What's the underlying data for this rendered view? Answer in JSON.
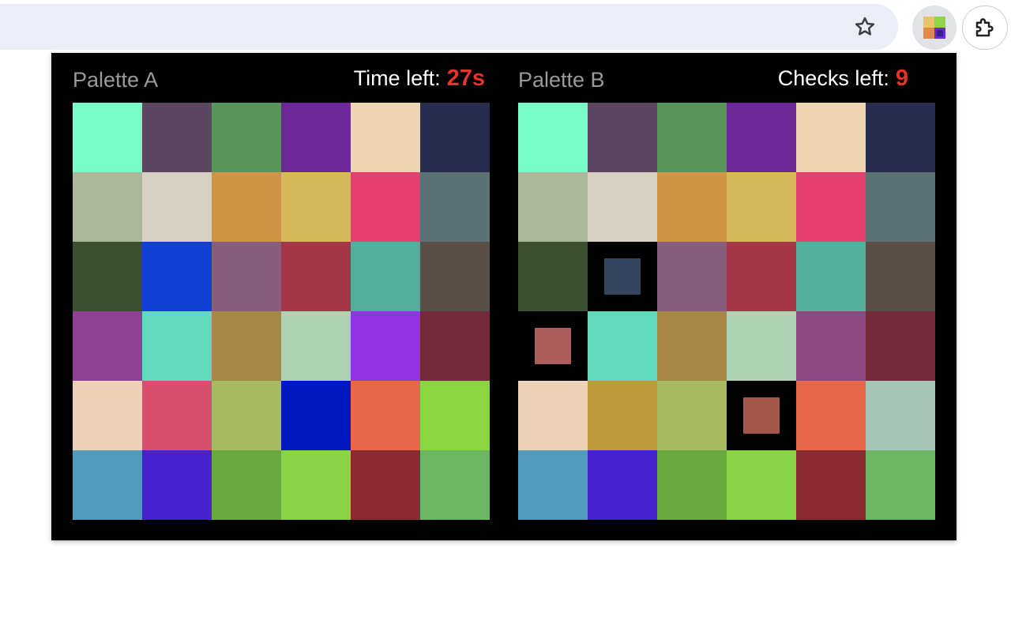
{
  "browser": {
    "star_icon": "star-outline-icon",
    "puzzle_icon": "puzzle-piece-icon",
    "extension_icon_colors": [
      "#e9c36b",
      "#8fd44a",
      "#e08a4a",
      "#6a2bd1"
    ],
    "extension_icon_inner": "#3a1f8e"
  },
  "palette_a": {
    "title": "Palette A",
    "stat_label": "Time left:",
    "stat_value": "27s",
    "cells": [
      "#78fbc6",
      "#5c4761",
      "#57955b",
      "#6b2896",
      "#edd4b3",
      "#282c4d",
      "#abb79a",
      "#d6d1c2",
      "#cf9346",
      "#d6b95a",
      "#e83f73",
      "#5b7374",
      "#3c4e32",
      "#1040d4",
      "#875e7c",
      "#a33648",
      "#54ae9b",
      "#5b5047",
      "#8d4294",
      "#62d9bc",
      "#a68745",
      "#add1b3",
      "#9333e3",
      "#742a3b",
      "#ecd2b8",
      "#d84e6f",
      "#a7ba62",
      "#0018c0",
      "#e6674a",
      "#8ad642",
      "#529bbd",
      "#4422cc",
      "#6aa942",
      "#8ad246",
      "#8a2b34",
      "#6cb562"
    ]
  },
  "palette_b": {
    "title": "Palette B",
    "stat_label": "Checks left:",
    "stat_value": "9",
    "cells": [
      {
        "color": "#78fbc6",
        "revealed": false
      },
      {
        "color": "#5c4761",
        "revealed": false
      },
      {
        "color": "#57955b",
        "revealed": false
      },
      {
        "color": "#6b2896",
        "revealed": false
      },
      {
        "color": "#edd4b3",
        "revealed": false
      },
      {
        "color": "#282c4d",
        "revealed": false
      },
      {
        "color": "#abb79a",
        "revealed": false
      },
      {
        "color": "#d6d1c2",
        "revealed": false
      },
      {
        "color": "#cf9346",
        "revealed": false
      },
      {
        "color": "#d6b95a",
        "revealed": false
      },
      {
        "color": "#e83f73",
        "revealed": false
      },
      {
        "color": "#5b7374",
        "revealed": false
      },
      {
        "color": "#3c4e32",
        "revealed": false
      },
      {
        "color": "#36445d",
        "revealed": true
      },
      {
        "color": "#875e7c",
        "revealed": false
      },
      {
        "color": "#a33648",
        "revealed": false
      },
      {
        "color": "#54ae9b",
        "revealed": false
      },
      {
        "color": "#5b5047",
        "revealed": false
      },
      {
        "color": "#ac5e5e",
        "revealed": true
      },
      {
        "color": "#62d9bc",
        "revealed": false
      },
      {
        "color": "#a68745",
        "revealed": false
      },
      {
        "color": "#add1b3",
        "revealed": false
      },
      {
        "color": "#8c4880",
        "revealed": false
      },
      {
        "color": "#742a3b",
        "revealed": false
      },
      {
        "color": "#ecd2b8",
        "revealed": false
      },
      {
        "color": "#bd9a3a",
        "revealed": false
      },
      {
        "color": "#a7ba62",
        "revealed": false
      },
      {
        "color": "#a4574b",
        "revealed": true
      },
      {
        "color": "#e6674a",
        "revealed": false
      },
      {
        "color": "#a6c4b8",
        "revealed": false
      },
      {
        "color": "#529bbd",
        "revealed": false
      },
      {
        "color": "#4422cc",
        "revealed": false
      },
      {
        "color": "#6aa942",
        "revealed": false
      },
      {
        "color": "#8ad246",
        "revealed": false
      },
      {
        "color": "#8a2b34",
        "revealed": false
      },
      {
        "color": "#6cb562",
        "revealed": false
      }
    ]
  }
}
